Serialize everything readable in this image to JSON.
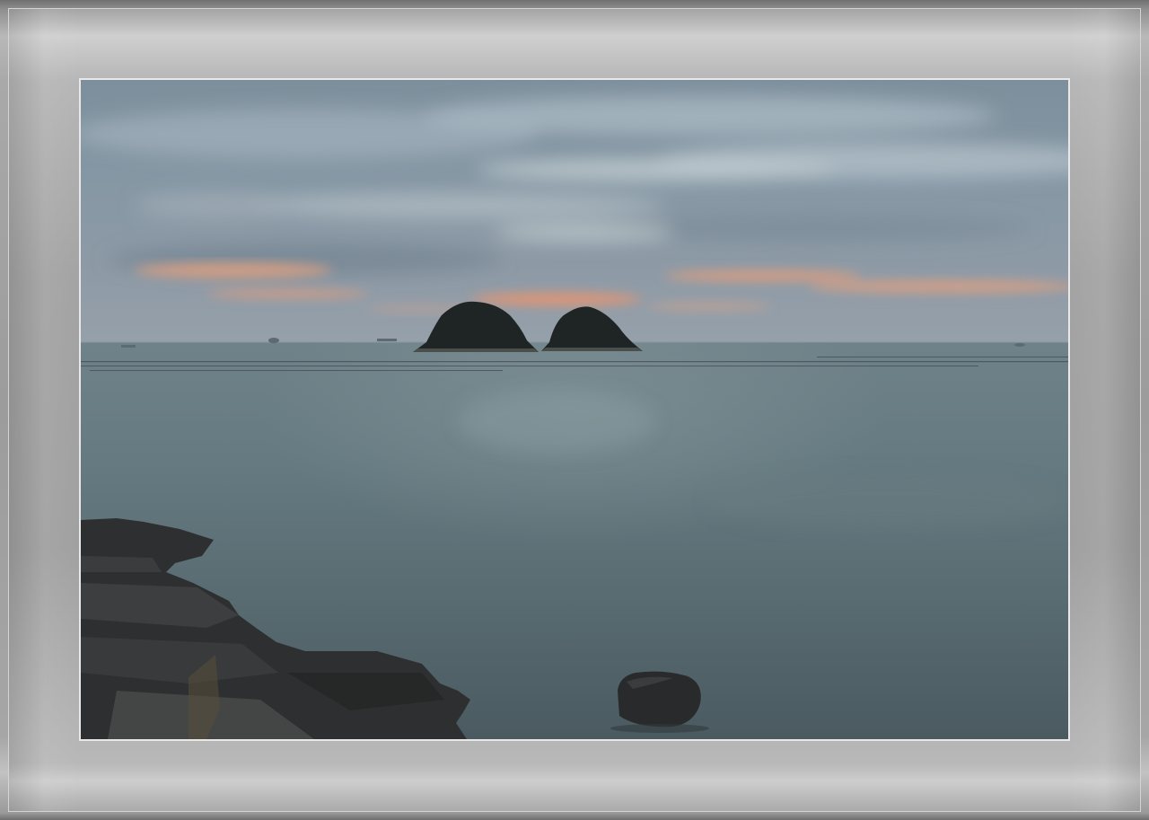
{
  "image": {
    "subject": "",
    "colors": {
      "mat": "#a4a4a4",
      "sky_top": "#7f909d",
      "sky_band": "#9fb0bd",
      "sunset_glow": "#e79a72",
      "sea": "#5d7178",
      "rocks": "#2a2b2c"
    }
  }
}
